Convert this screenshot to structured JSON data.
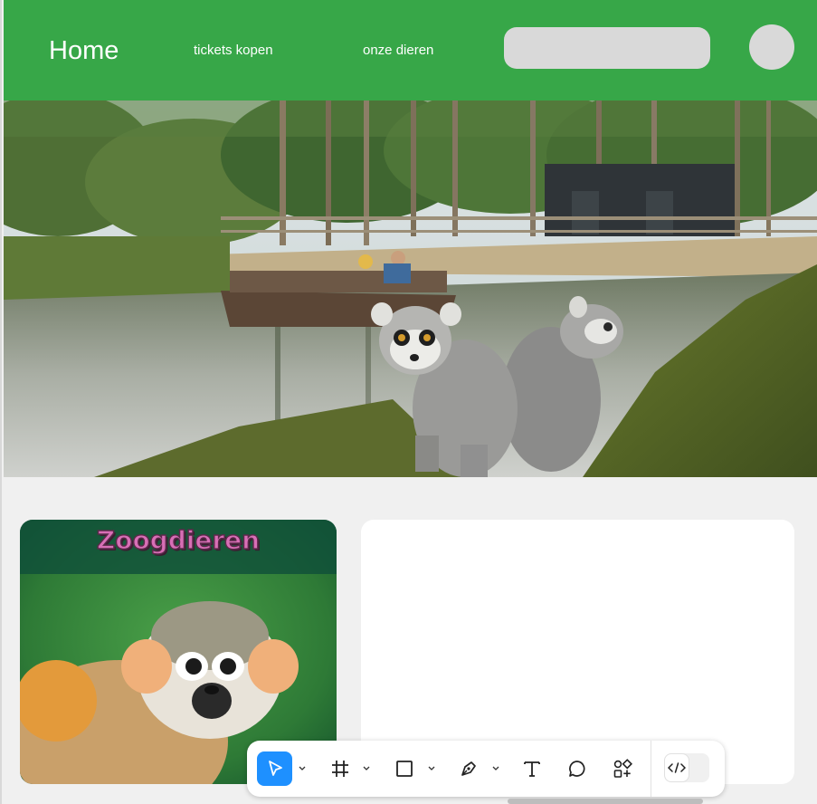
{
  "header": {
    "home_label": "Home",
    "nav": [
      "tickets kopen",
      "onze dieren"
    ],
    "search_placeholder": ""
  },
  "card": {
    "title": "Zoogdieren"
  },
  "toolbar": {
    "tools": [
      "move-tool",
      "frame-tool",
      "rectangle-tool",
      "pen-tool",
      "text-tool",
      "comment-tool",
      "components-tool",
      "dev-mode-toggle"
    ]
  },
  "colors": {
    "header_green": "#37a748",
    "accent_blue": "#1e90ff",
    "placeholder_gray": "#d9d9d9"
  }
}
